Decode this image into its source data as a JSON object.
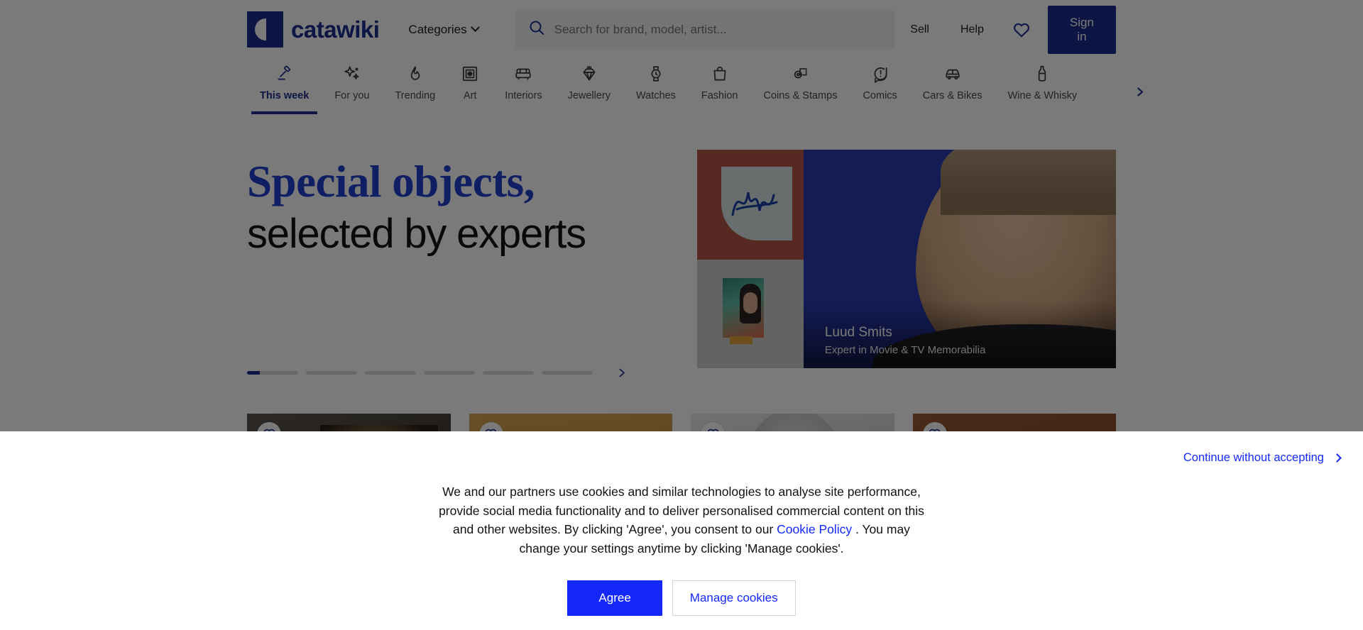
{
  "brand": {
    "name": "catawiki",
    "logo_icon": "catawiki-logo-icon",
    "accent": "#1A2D8E"
  },
  "header": {
    "categories_label": "Categories",
    "categories_chevron_icon": "chevron-down-icon",
    "search_icon": "search-icon",
    "search_placeholder": "Search for brand, model, artist...",
    "search_value": "",
    "sell_label": "Sell",
    "help_label": "Help",
    "favourites_icon": "heart-icon",
    "signin_label": "Sign in"
  },
  "category_nav": {
    "next_icon": "chevron-right-icon",
    "items": [
      {
        "label": "This week",
        "icon": "gavel-icon",
        "active": true
      },
      {
        "label": "For you",
        "icon": "sparkles-icon",
        "active": false
      },
      {
        "label": "Trending",
        "icon": "flame-icon",
        "active": false
      },
      {
        "label": "Art",
        "icon": "framed-art-icon",
        "active": false
      },
      {
        "label": "Interiors",
        "icon": "sofa-icon",
        "active": false
      },
      {
        "label": "Jewellery",
        "icon": "gem-icon",
        "active": false
      },
      {
        "label": "Watches",
        "icon": "watch-icon",
        "active": false
      },
      {
        "label": "Fashion",
        "icon": "handbag-icon",
        "active": false
      },
      {
        "label": "Coins & Stamps",
        "icon": "coin-stamp-icon",
        "active": false
      },
      {
        "label": "Comics",
        "icon": "speech-bubble-icon",
        "active": false
      },
      {
        "label": "Cars & Bikes",
        "icon": "car-icon",
        "active": false
      },
      {
        "label": "Wine & Whisky",
        "icon": "bottle-icon",
        "active": false
      }
    ]
  },
  "hero": {
    "headline_line1": "Special objects,",
    "headline_line2": "selected by experts",
    "headline_line1_color": "#2340D0",
    "next_icon": "chevron-right-icon",
    "progress": {
      "total": 6,
      "current": 1,
      "current_fill_percent": 25
    },
    "expert": {
      "name": "Luud Smits",
      "role": "Expert in Movie & TV Memorabilia"
    },
    "collage": {
      "top_left_alt": "signed-autograph-card",
      "bottom_left_alt": "princess-leia-signed-photo",
      "main_alt": "expert-portrait-blue-background"
    }
  },
  "cards": [
    {
      "favourite_icon": "heart-icon",
      "alt": "costumed-figure-in-hat"
    },
    {
      "favourite_icon": "heart-icon",
      "alt": "wooden-interior-with-arch"
    },
    {
      "favourite_icon": "heart-icon",
      "alt": "black-and-white-portrait"
    },
    {
      "favourite_icon": "heart-icon",
      "alt": "framed-blue-artwork"
    }
  ],
  "cookie_banner": {
    "continue_without_accepting": "Continue without accepting",
    "continue_chevron_icon": "chevron-right-icon",
    "text_part1": "We and our partners use cookies and similar technologies to analyse site performance, provide social media functionality and to deliver personalised commercial content on this and other websites. By clicking 'Agree', you consent to our",
    "policy_link": "Cookie Policy",
    "text_part2": ". You may change your settings anytime by clicking 'Manage cookies'.",
    "agree_label": "Agree",
    "manage_label": "Manage cookies",
    "agree_color": "#1429F9"
  }
}
